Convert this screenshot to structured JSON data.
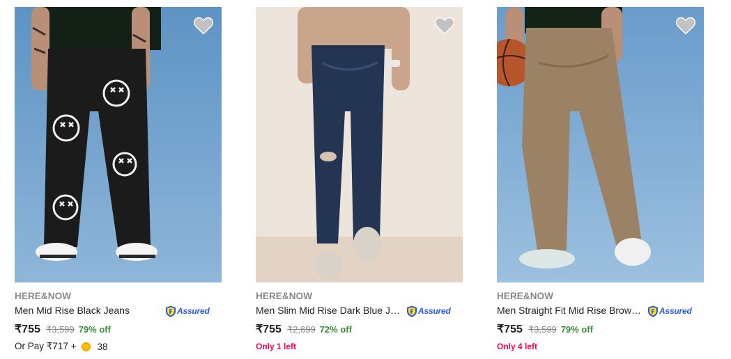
{
  "products": [
    {
      "brand": "HERE&NOW",
      "title": "Men Mid Rise Black Jeans",
      "assured_label": "Assured",
      "price": "₹755",
      "mrp": "₹3,599",
      "discount": "79% off",
      "pay_prefix": "Or Pay ₹717 +",
      "coin_icon": "supercoin-icon",
      "coins": "38",
      "stock": ""
    },
    {
      "brand": "HERE&NOW",
      "title": "Men Slim Mid Rise Dark Blue Je...",
      "assured_label": "Assured",
      "price": "₹755",
      "mrp": "₹2,699",
      "discount": "72% off",
      "stock": "Only 1 left"
    },
    {
      "brand": "HERE&NOW",
      "title": "Men Straight Fit Mid Rise Brown ...",
      "assured_label": "Assured",
      "price": "₹755",
      "mrp": "₹3,599",
      "discount": "79% off",
      "stock": "Only 4 left"
    }
  ],
  "colors": {
    "discount_green": "#388e3c",
    "stock_pink": "#ff0059",
    "assured_blue": "#2a55e5",
    "muted_grey": "#878787"
  }
}
